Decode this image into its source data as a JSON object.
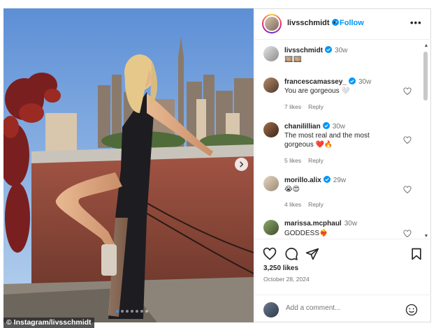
{
  "post": {
    "username": "livsschmidt",
    "separator": "•",
    "follow_label": "Follow",
    "more_label": "•••",
    "watermark": "© Instagram/livsschmidt",
    "carousel_index": 1,
    "carousel_count": 7
  },
  "caption": {
    "username": "livsschmidt",
    "time": "30w",
    "text": "🎞️🎞️"
  },
  "comments": [
    {
      "username": "francescamassey_",
      "verified": true,
      "time": "30w",
      "text": "You are gorgeous 🤍",
      "likes": "7 likes",
      "reply": "Reply"
    },
    {
      "username": "chanilillian",
      "verified": true,
      "time": "30w",
      "text": "The most real and the most gorgeous ❤️🔥",
      "likes": "5 likes",
      "reply": "Reply"
    },
    {
      "username": "morillo.alix",
      "verified": true,
      "time": "29w",
      "text": "😭😍",
      "likes": "4 likes",
      "reply": "Reply"
    },
    {
      "username": "marissa.mcphaul",
      "verified": false,
      "time": "30w",
      "text": "GODDESS❤️‍🔥",
      "likes": "",
      "reply": ""
    }
  ],
  "actions": {
    "likes": "3,250 likes",
    "date": "October 28, 2024"
  },
  "add_comment": {
    "placeholder": "Add a comment..."
  },
  "colors": {
    "accent": "#0095f6",
    "muted": "#737373",
    "border": "#dbdbdb"
  }
}
